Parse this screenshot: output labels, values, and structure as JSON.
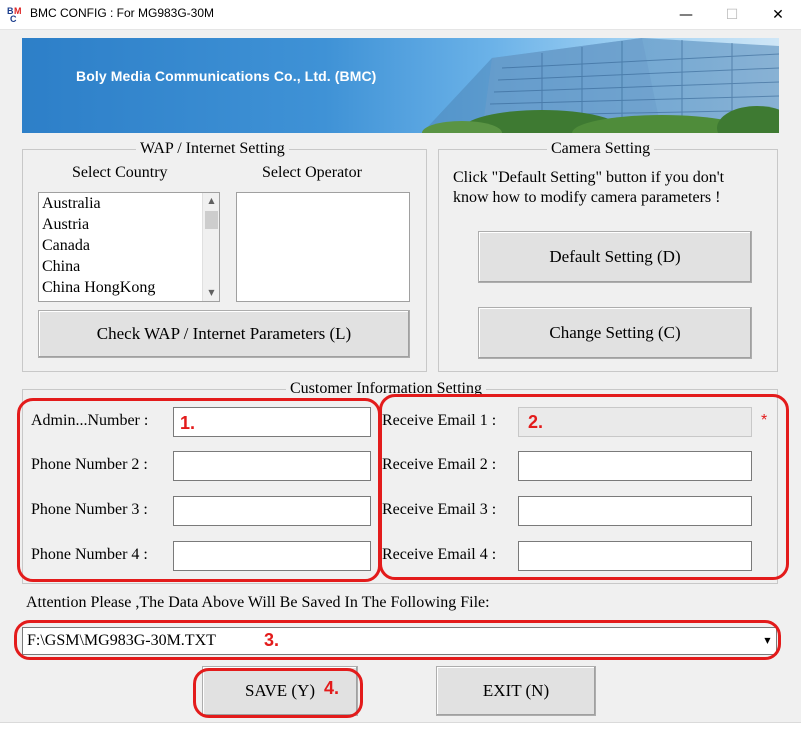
{
  "window": {
    "title": "BMC CONFIG : For MG983G-30M",
    "minimize_glyph": "—",
    "maximize_glyph": "☐",
    "close_glyph": "✕"
  },
  "banner": {
    "company": "Boly Media Communications Co., Ltd. (BMC)"
  },
  "wap": {
    "title": "WAP / Internet Setting",
    "country_label": "Select Country",
    "operator_label": "Select Operator",
    "countries": [
      "Australia",
      "Austria",
      "Canada",
      "China",
      "China HongKong"
    ],
    "check_button": "Check WAP / Internet Parameters (L)"
  },
  "camera": {
    "title": "Camera Setting",
    "hint_line1": "Click \"Default Setting\" button if you don't",
    "hint_line2": "know how to modify camera parameters !",
    "default_button": "Default Setting (D)",
    "change_button": "Change Setting (C)"
  },
  "customer": {
    "title": "Customer Information Setting",
    "phones": [
      {
        "label": "Admin...Number :",
        "value": ""
      },
      {
        "label": "Phone Number 2 :",
        "value": ""
      },
      {
        "label": "Phone Number 3 :",
        "value": ""
      },
      {
        "label": "Phone Number 4 :",
        "value": ""
      }
    ],
    "emails": [
      {
        "label": "Receive Email 1 :",
        "value": ""
      },
      {
        "label": "Receive Email 2 :",
        "value": ""
      },
      {
        "label": "Receive Email 3 :",
        "value": ""
      },
      {
        "label": "Receive Email 4 :",
        "value": ""
      }
    ],
    "required_mark": "*"
  },
  "file": {
    "attention": "Attention Please ,The Data Above Will Be Saved In The Following  File:",
    "path": "F:\\GSM\\MG983G-30M.TXT"
  },
  "footer": {
    "save_button": "SAVE (Y)",
    "exit_button": "EXIT (N)"
  },
  "annotations": {
    "n1": "1.",
    "n2": "2.",
    "n3": "3.",
    "n4": "4.",
    "color": "#e31b1b"
  },
  "icons": {
    "scroll_up": "▲",
    "scroll_down": "▼",
    "combo_dropdown": "▼"
  }
}
